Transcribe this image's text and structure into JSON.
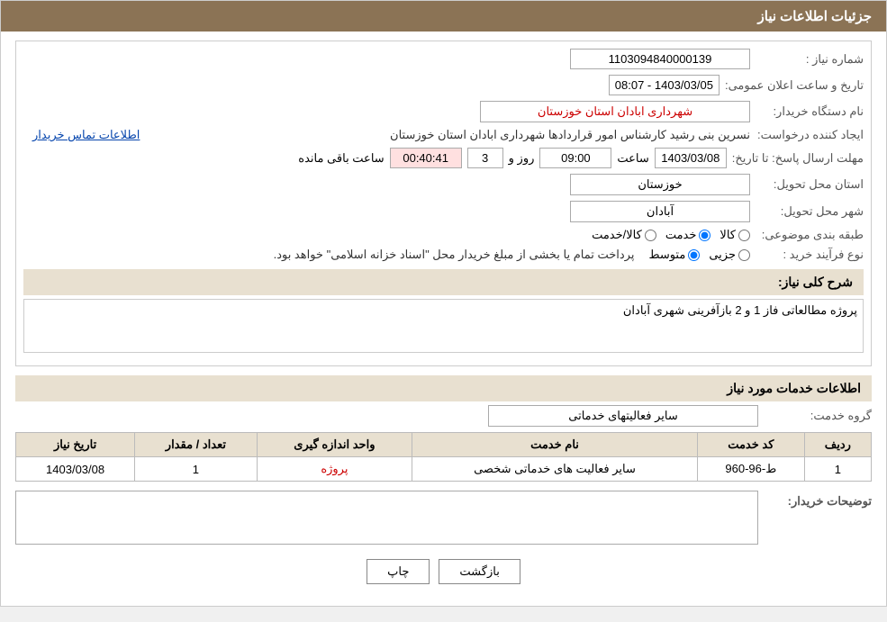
{
  "header": {
    "title": "جزئیات اطلاعات نیاز"
  },
  "fields": {
    "shomare_niaz_label": "شماره نیاز :",
    "shomare_niaz_value": "1103094840000139",
    "nam_dastgah_label": "نام دستگاه خریدار:",
    "nam_dastgah_value": "شهرداری ابادان استان خوزستان",
    "ijad_konande_label": "ایجاد کننده درخواست:",
    "ijad_konande_value": "نسرین بنی رشید کارشناس امور قراردادها شهرداری ابادان استان خوزستان",
    "etelaat_tamas_label": "اطلاعات تماس خریدار",
    "mohlet_label": "مهلت ارسال پاسخ: تا تاریخ:",
    "mohlet_date": "1403/03/08",
    "mohlet_saat_label": "ساعت",
    "mohlet_saat_value": "09:00",
    "mohlet_rooz_label": "روز و",
    "mohlet_rooz_value": "3",
    "mohlet_countdown": "00:40:41",
    "mohlet_baqi_label": "ساعت باقی مانده",
    "tarikh_label": "تاریخ و ساعت اعلان عمومی:",
    "tarikh_value": "1403/03/05 - 08:07",
    "ostan_label": "استان محل تحویل:",
    "ostan_value": "خوزستان",
    "shahr_label": "شهر محل تحویل:",
    "shahr_value": "آبادان",
    "tabaqe_label": "طبقه بندی موضوعی:",
    "tabaqe_kala": "کالا",
    "tabaqe_khadamat": "خدمت",
    "tabaqe_kala_khadamat": "کالا/خدمت",
    "now_label": "نوع فرآیند خرید :",
    "now_jozii": "جزیی",
    "now_motavasset": "متوسط",
    "now_description": "پرداخت تمام یا بخشی از مبلغ خریدار محل \"اسناد خزانه اسلامی\" خواهد بود.",
    "sharh_label": "شرح کلی نیاز:",
    "sharh_value": "پروژه مطالعاتی فاز 1 و 2 بازآفرینی شهری آبادان",
    "khadamat_section": "اطلاعات خدمات مورد نیاز",
    "goroh_label": "گروه خدمت:",
    "goroh_value": "سایر فعالیتهای خدماتی"
  },
  "table": {
    "headers": [
      "ردیف",
      "کد خدمت",
      "نام خدمت",
      "واحد اندازه گیری",
      "تعداد / مقدار",
      "تاریخ نیاز"
    ],
    "rows": [
      {
        "radif": "1",
        "kod": "ط-96-960",
        "name": "سایر فعالیت های خدماتی شخصی",
        "vahed": "پروژه",
        "tedad": "1",
        "tarikh": "1403/03/08"
      }
    ]
  },
  "buyer_description_label": "توضیحات خریدار:",
  "buyer_description_value": "",
  "buttons": {
    "print": "چاپ",
    "back": "بازگشت"
  }
}
